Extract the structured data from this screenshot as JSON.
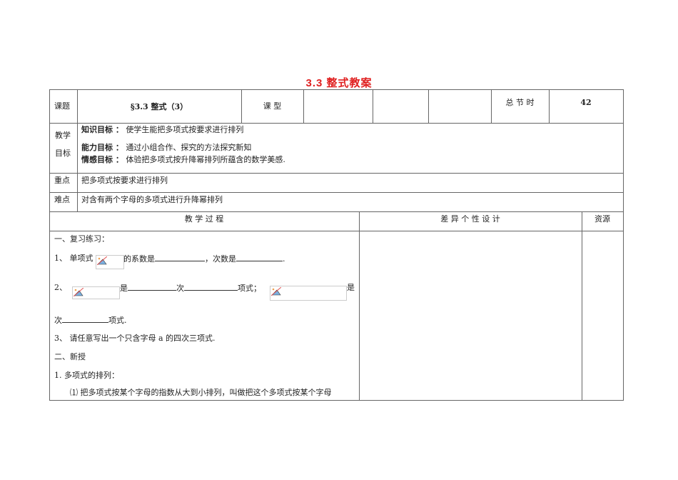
{
  "title": "3.3  整式教案",
  "header": {
    "topic_label": "课题",
    "topic": "§3.3  整式（3）",
    "type_label": "课  型",
    "total_label": "总 节 时",
    "total_value": "42"
  },
  "objectives": {
    "label1": "教学",
    "label2": "目标",
    "items": [
      {
        "name": "知识目标 ：",
        "text": "使学生能把多项式按要求进行排列"
      },
      {
        "name": "能力目标 ：",
        "text": "通过小组合作、探究的方法探究新知"
      },
      {
        "name": "情感目标 ：",
        "text": "体验把多项式按升降幂排列所蕴含的数学美感."
      }
    ]
  },
  "key": {
    "label": "重点",
    "text": "把多项式按要求进行排列"
  },
  "difficulty": {
    "label": "难点",
    "text": "对含有两个字母的多项式进行升降幂排列"
  },
  "columns": {
    "process": "教 学 过 程",
    "design": "差 异 个 性 设 计",
    "resources": "资源"
  },
  "process": {
    "s1": "一、复习练习：",
    "q1a": "1、   单项式",
    "q1b": "的系数是",
    "q1c": "，次数是",
    "q1d": ".",
    "q2a": "2、",
    "q2b": "是",
    "q2c": "次",
    "q2d": "项式；",
    "q2e": "是",
    "q2f": "次",
    "q2g": "项式.",
    "q3": "3、   请任意写出一个只含字母 a 的四次三项式.",
    "s2": "二、新授",
    "n1": "1.    多项式的排列：",
    "n1a": "⑴ 把多项式按某个字母的指数从大到小排列，叫做把这个多项式按某个字母"
  }
}
